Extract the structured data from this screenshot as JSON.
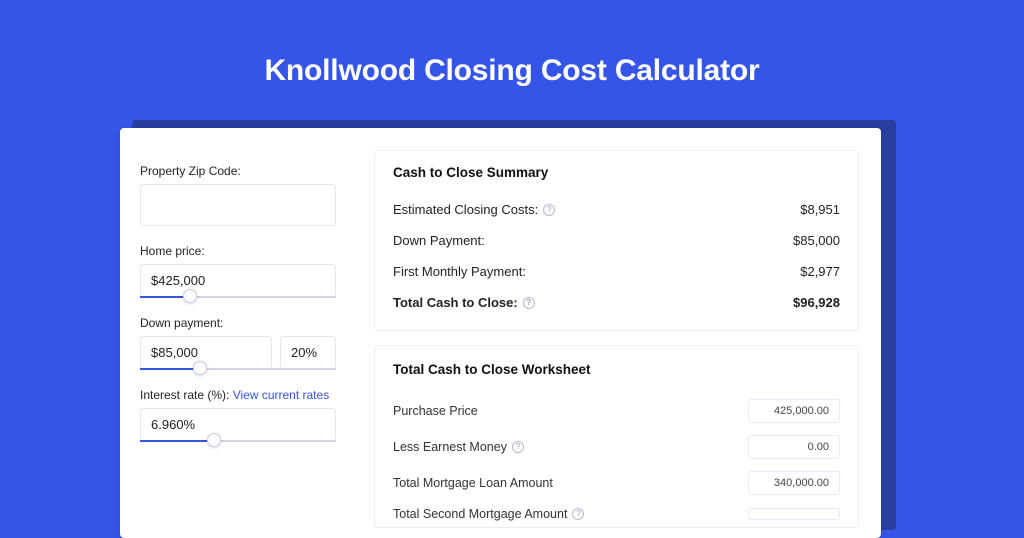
{
  "header": {
    "title": "Knollwood Closing Cost Calculator"
  },
  "inputs": {
    "zip": {
      "label": "Property Zip Code:",
      "value": ""
    },
    "home_price": {
      "label": "Home price:",
      "value": "$425,000",
      "slider": {
        "fill_pct": 22,
        "thumb_pct": 22
      }
    },
    "down_payment": {
      "label": "Down payment:",
      "value": "$85,000",
      "pct": "20%",
      "slider": {
        "fill_pct": 27,
        "thumb_pct": 27
      }
    },
    "interest": {
      "label": "Interest rate (%): ",
      "link": "View current rates",
      "value": "6.960%",
      "slider": {
        "fill_pct": 34,
        "thumb_pct": 34
      }
    }
  },
  "summary": {
    "title": "Cash to Close Summary",
    "rows": [
      {
        "label": "Estimated Closing Costs:",
        "help": true,
        "value": "$8,951"
      },
      {
        "label": "Down Payment:",
        "help": false,
        "value": "$85,000"
      },
      {
        "label": "First Monthly Payment:",
        "help": false,
        "value": "$2,977"
      }
    ],
    "total": {
      "label": "Total Cash to Close:",
      "help": true,
      "value": "$96,928"
    }
  },
  "worksheet": {
    "title": "Total Cash to Close Worksheet",
    "rows": [
      {
        "label": "Purchase Price",
        "help": false,
        "value": "425,000.00"
      },
      {
        "label": "Less Earnest Money",
        "help": true,
        "value": "0.00"
      },
      {
        "label": "Total Mortgage Loan Amount",
        "help": false,
        "value": "340,000.00"
      },
      {
        "label": "Total Second Mortgage Amount",
        "help": true,
        "value": ""
      }
    ]
  }
}
